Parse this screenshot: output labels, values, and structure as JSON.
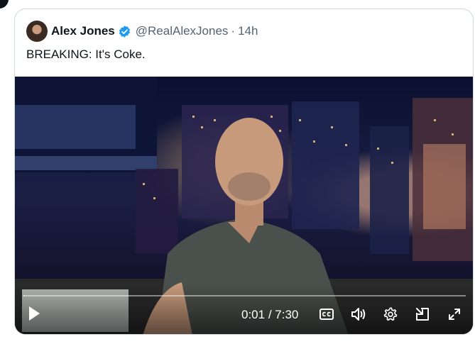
{
  "tweet": {
    "author_name": "Alex Jones",
    "handle": "@RealAlexJones",
    "separator": "·",
    "time": "14h",
    "text": "BREAKING: It's Coke."
  },
  "video": {
    "current_time": "0:01",
    "duration": "7:30",
    "progress_fraction": 0.0022
  },
  "icons": {
    "verified": "verified-badge-icon",
    "play": "play-icon",
    "captions": "captions-icon",
    "volume": "volume-icon",
    "settings": "gear-icon",
    "pip": "picture-in-picture-icon",
    "fullscreen": "fullscreen-icon"
  },
  "colors": {
    "verified_blue": "#1d9bf0",
    "secondary_text": "#536471",
    "border": "#cfd9de"
  }
}
